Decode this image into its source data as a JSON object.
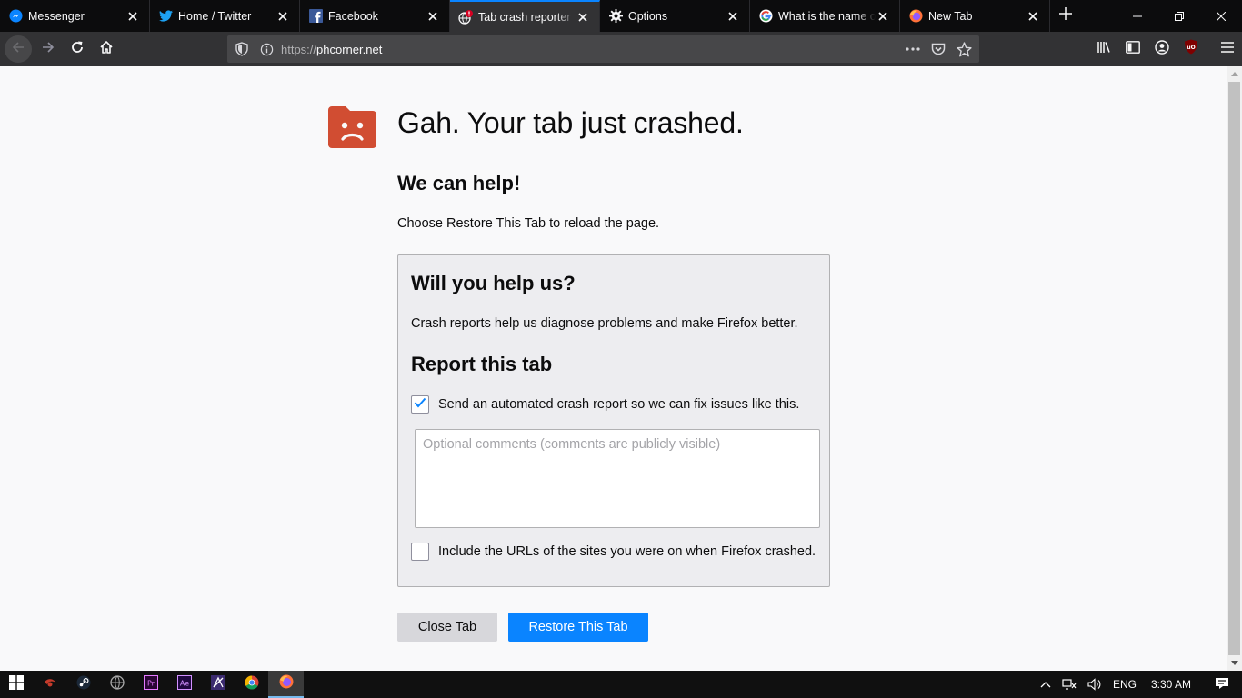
{
  "tabs": [
    {
      "title": "Messenger",
      "icon": "messenger-icon"
    },
    {
      "title": "Home / Twitter",
      "icon": "twitter-icon"
    },
    {
      "title": "Facebook",
      "icon": "facebook-icon"
    },
    {
      "title": "Tab crash reporter",
      "icon": "crashed-globe-icon",
      "selected": true
    },
    {
      "title": "Options",
      "icon": "gear-icon"
    },
    {
      "title": "What is the name of",
      "icon": "google-icon"
    },
    {
      "title": "New Tab",
      "icon": "firefox-icon"
    }
  ],
  "navbar": {
    "url_host": "phcorner.net",
    "url_protocol": "https://"
  },
  "crash": {
    "title": "Gah. Your tab just crashed.",
    "help_heading": "We can help!",
    "help_text": "Choose Restore This Tab to reload the page."
  },
  "report": {
    "heading": "Will you help us?",
    "description": "Crash reports help us diagnose problems and make Firefox better.",
    "report_heading": "Report this tab",
    "send_label": "Send an automated crash report so we can fix issues like this.",
    "send_checked": true,
    "comments_placeholder": "Optional comments (comments are publicly visible)",
    "include_urls_label": "Include the URLs of the sites you were on when Firefox crashed.",
    "include_urls_checked": false
  },
  "buttons": {
    "close_tab": "Close Tab",
    "restore_tab": "Restore This Tab"
  },
  "taskbar": {
    "language": "ENG",
    "time": "3:30 AM"
  },
  "colors": {
    "accent": "#0a84ff",
    "crash_icon": "#d14d32"
  }
}
